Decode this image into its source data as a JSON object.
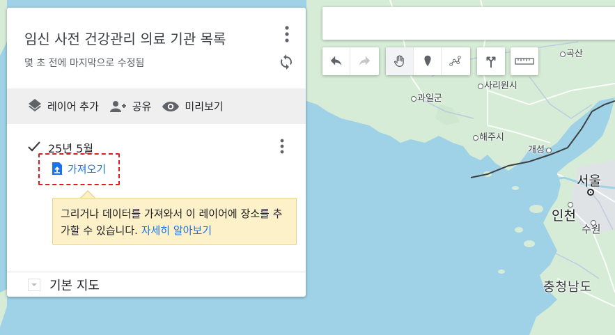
{
  "panel": {
    "map_title": "임신 사전 건강관리 의료 기관 목록",
    "last_edited": "몇 초 전에 마지막으로 수정됨",
    "actions": {
      "add_layer": "레이어 추가",
      "share": "공유",
      "preview": "미리보기"
    },
    "layer": {
      "name": "25년 5월",
      "checked": true,
      "import_label": "가져오기"
    },
    "tooltip": {
      "text": "그리거나 데이터를 가져와서 이 레이어에 장소를 추가할 수 있습니다.",
      "link": "자세히 알아보기"
    },
    "base_map_label": "기본 지도"
  },
  "search": {
    "value": "",
    "placeholder": ""
  },
  "toolbar": {
    "icons": [
      "undo-icon",
      "redo-icon",
      "pan-hand-icon",
      "add-marker-icon",
      "draw-line-icon",
      "directions-icon",
      "measure-ruler-icon"
    ]
  },
  "map_labels": {
    "gosan": "곡산",
    "sariwon": "사리원시",
    "gwail": "과일군",
    "haeju": "해주시",
    "kaesong": "개성",
    "seoul": "서울",
    "incheon": "인천",
    "suwon": "수원",
    "chungnam": "충청남도"
  },
  "colors": {
    "water": "#9fd2e6",
    "land": "#d6ecd6",
    "accent": "#1a73e8",
    "highlight_border": "#e01b24",
    "tooltip_bg": "#fdf1c9",
    "action_bar_bg": "#efefef"
  }
}
